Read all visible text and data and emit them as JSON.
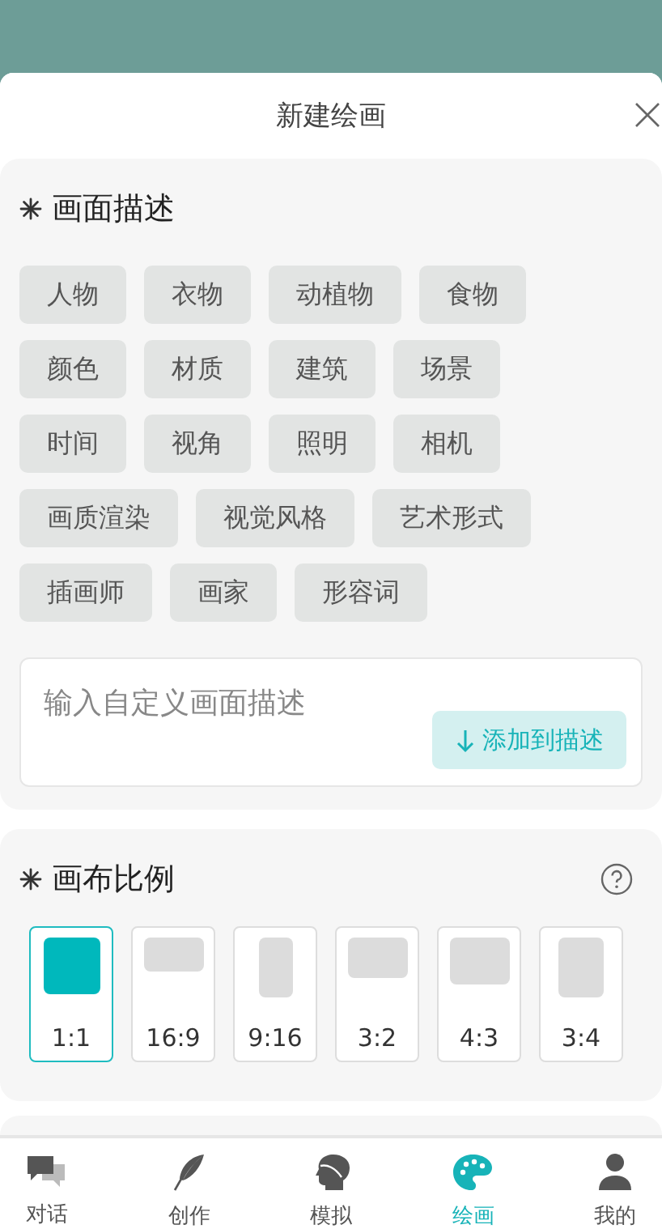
{
  "header": {
    "title": "新建绘画"
  },
  "description": {
    "title": "画面描述",
    "tags": [
      "人物",
      "衣物",
      "动植物",
      "食物",
      "颜色",
      "材质",
      "建筑",
      "场景",
      "时间",
      "视角",
      "照明",
      "相机",
      "画质渲染",
      "视觉风格",
      "艺术形式",
      "插画师",
      "画家",
      "形容词"
    ],
    "input": {
      "placeholder": "输入自定义画面描述"
    },
    "add_button": "添加到描述"
  },
  "ratio": {
    "title": "画布比例",
    "options": [
      {
        "label": "1:1",
        "kind": "square",
        "selected": true
      },
      {
        "label": "16:9",
        "kind": "wide",
        "selected": false
      },
      {
        "label": "9:16",
        "kind": "tall",
        "selected": false
      },
      {
        "label": "3:2",
        "kind": "landscape",
        "selected": false
      },
      {
        "label": "4:3",
        "kind": "standard",
        "selected": false
      },
      {
        "label": "3:4",
        "kind": "portrait",
        "selected": false
      }
    ]
  },
  "tabbar": [
    {
      "label": "对话",
      "kind": "chat",
      "selected": false
    },
    {
      "label": "创作",
      "kind": "quill",
      "selected": false
    },
    {
      "label": "模拟",
      "kind": "head",
      "selected": false
    },
    {
      "label": "绘画",
      "kind": "palette",
      "selected": true
    },
    {
      "label": "我的",
      "kind": "person",
      "selected": false
    }
  ]
}
